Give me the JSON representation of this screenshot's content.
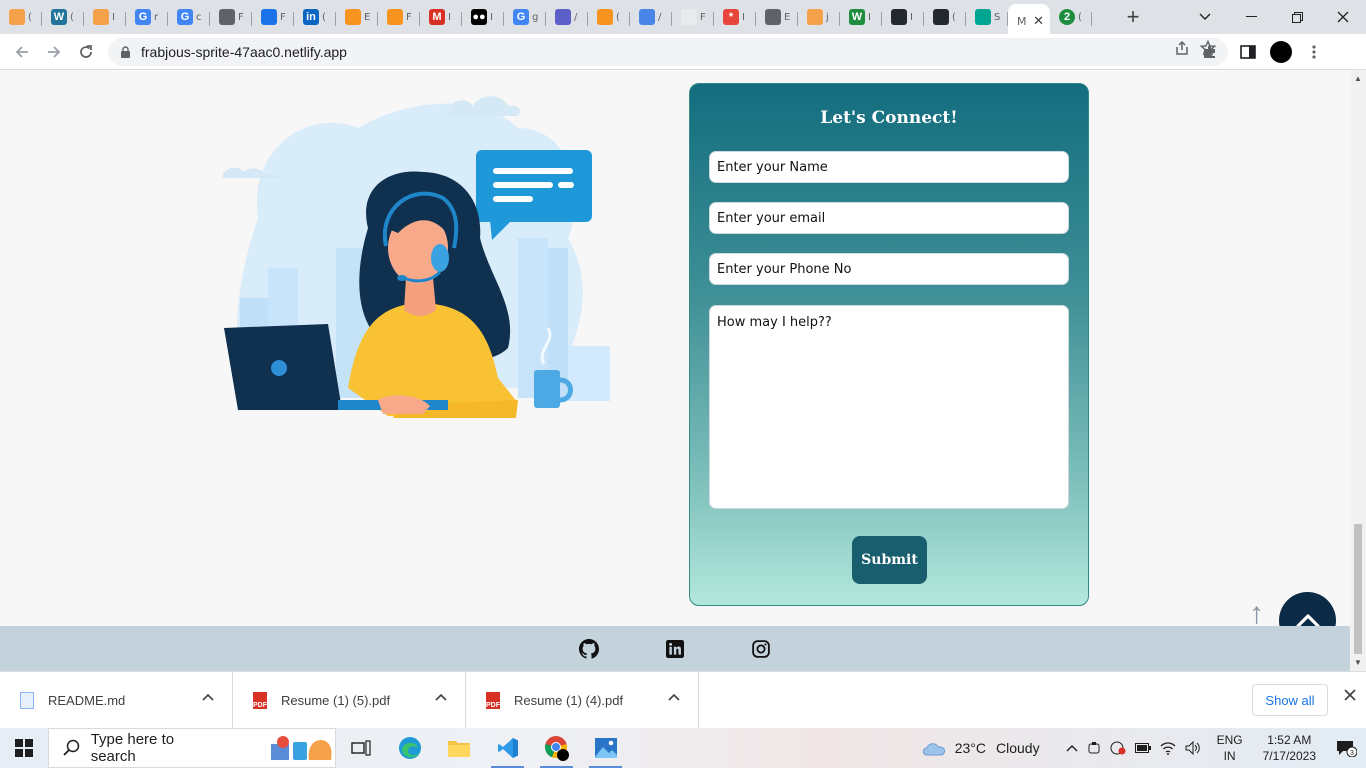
{
  "browser": {
    "tabs": [
      {
        "icon": "blog-icon",
        "letter": "",
        "color": "#f4a14a",
        "label": "("
      },
      {
        "icon": "wordpress-icon",
        "letter": "W",
        "color": "#21759b",
        "label": "("
      },
      {
        "icon": "blog-icon",
        "letter": "",
        "color": "#f4a14a",
        "label": "I"
      },
      {
        "icon": "google-icon",
        "letter": "G",
        "color": "#4285f4",
        "label": "r"
      },
      {
        "icon": "google-icon",
        "letter": "G",
        "color": "#4285f4",
        "label": "c"
      },
      {
        "icon": "graduation-cap-icon",
        "letter": "",
        "color": "#5f6368",
        "label": "F"
      },
      {
        "icon": "flag-icon",
        "letter": "",
        "color": "#1a73e8",
        "label": "F"
      },
      {
        "icon": "linkedin-icon",
        "letter": "in",
        "color": "#0a66c2",
        "label": "("
      },
      {
        "icon": "hashnode-icon",
        "letter": "",
        "color": "#f7931e",
        "label": "E"
      },
      {
        "icon": "hashnode-icon",
        "letter": "",
        "color": "#f7931e",
        "label": "F"
      },
      {
        "icon": "gmail-icon",
        "letter": "M",
        "color": "#d93025",
        "label": "I"
      },
      {
        "icon": "medium-icon",
        "letter": "●●",
        "color": "#000000",
        "label": "I"
      },
      {
        "icon": "google-icon",
        "letter": "G",
        "color": "#4285f4",
        "label": "g"
      },
      {
        "icon": "teams-icon",
        "letter": "",
        "color": "#5b5fc7",
        "label": "/"
      },
      {
        "icon": "hashnode-icon",
        "letter": "",
        "color": "#f7931e",
        "label": "("
      },
      {
        "icon": "app-icon",
        "letter": "",
        "color": "#4a86e8",
        "label": "/"
      },
      {
        "icon": "blank-icon",
        "letter": "",
        "color": "#e8eaed",
        "label": "F"
      },
      {
        "icon": "asterisk-icon",
        "letter": "*",
        "color": "#e8453c",
        "label": "I"
      },
      {
        "icon": "globe-icon",
        "letter": "",
        "color": "#5f6368",
        "label": "E"
      },
      {
        "icon": "blog-icon",
        "letter": "",
        "color": "#f4a14a",
        "label": "j"
      },
      {
        "icon": "w-icon",
        "letter": "W",
        "color": "#1e8e3e",
        "label": "I"
      },
      {
        "icon": "github-icon",
        "letter": "",
        "color": "#24292f",
        "label": "I"
      },
      {
        "icon": "github-icon",
        "letter": "",
        "color": "#24292f",
        "label": "("
      },
      {
        "icon": "diamond-icon",
        "letter": "",
        "color": "#00a693",
        "label": "S"
      }
    ],
    "active_tab": {
      "label": "M",
      "close": "✕"
    },
    "extra_tab": {
      "icon": "notification-icon",
      "letter": "2",
      "color": "#1e8e3e",
      "label": "("
    },
    "new_tab": "+",
    "url": "frabjous-sprite-47aac0.netlify.app"
  },
  "page": {
    "contact": {
      "title": "Let's Connect!",
      "name_placeholder": "Enter your Name",
      "email_placeholder": "Enter your email",
      "phone_placeholder": "Enter your Phone No",
      "message_placeholder": "How may I help??",
      "submit_label": "Submit"
    },
    "up_arrow": "↑",
    "footer_links": [
      "github-icon",
      "linkedin-icon",
      "instagram-icon"
    ]
  },
  "downloads": {
    "items": [
      {
        "name": "README.md",
        "type": "md"
      },
      {
        "name": "Resume (1) (5).pdf",
        "type": "pdf"
      },
      {
        "name": "Resume (1) (4).pdf",
        "type": "pdf"
      }
    ],
    "show_all": "Show all"
  },
  "taskbar": {
    "search_placeholder": "Type here to search",
    "weather_temp": "23°C",
    "weather_desc": "Cloudy",
    "lang_line1": "ENG",
    "lang_line2": "IN",
    "time": "1:52 AM",
    "date": "7/17/2023",
    "notification_count": "3"
  }
}
